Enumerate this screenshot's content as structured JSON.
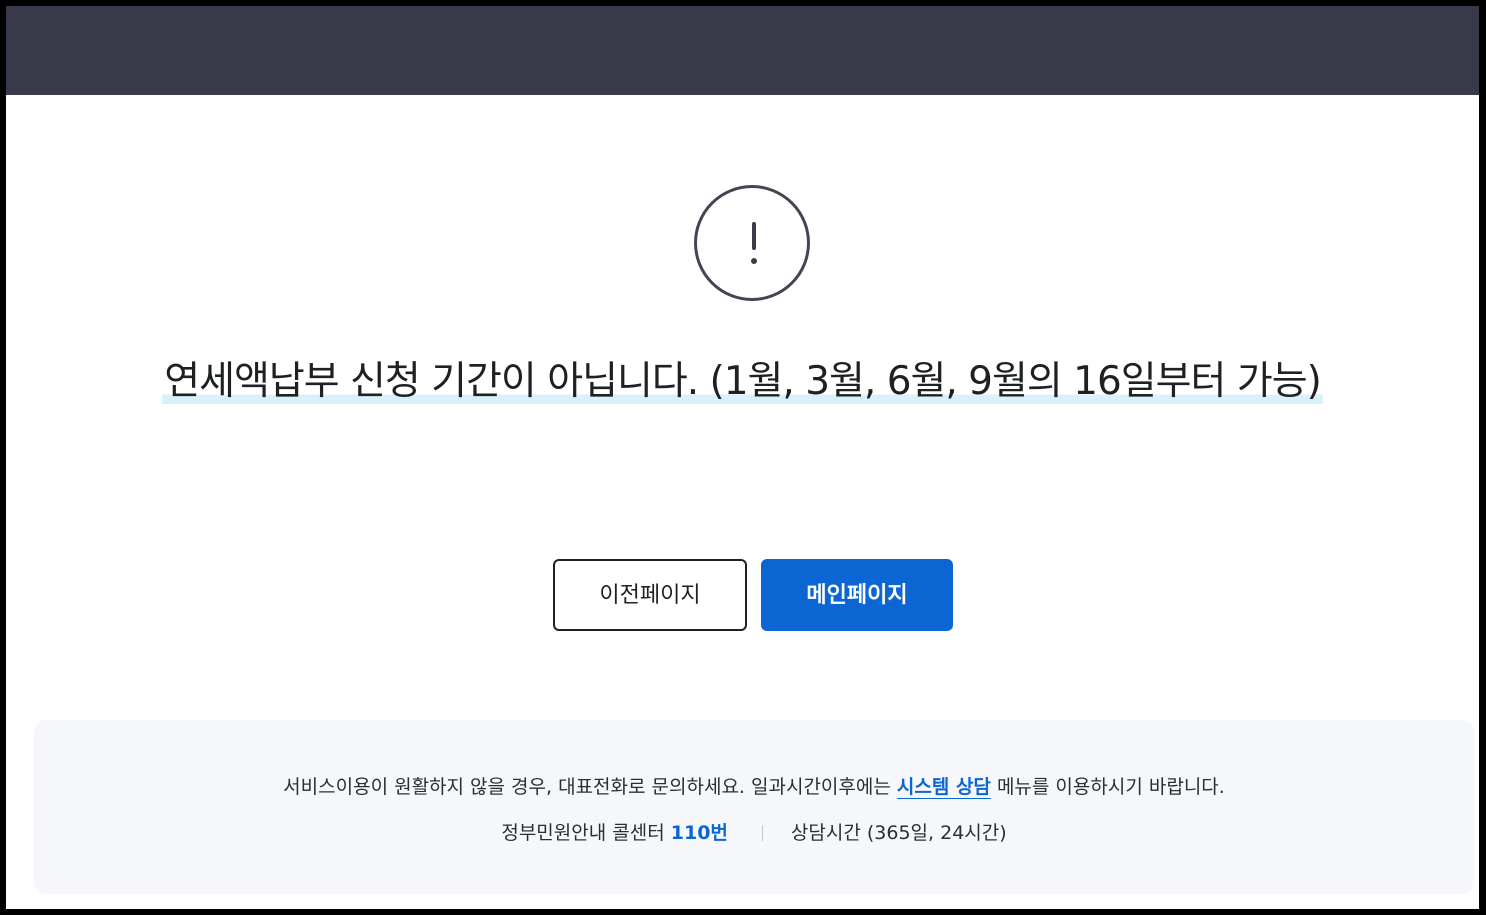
{
  "message": {
    "text": "연세액납부 신청 기간이 아닙니다. (1월, 3월, 6월, 9월의 16일부터 가능)"
  },
  "icons": {
    "alert": "exclamation-circle-icon"
  },
  "buttons": {
    "prev_label": "이전페이지",
    "main_label": "메인페이지"
  },
  "footer": {
    "line1_prefix": "서비스이용이 원활하지 않을 경우, 대표전화로 문의하세요. 일과시간이후에는 ",
    "line1_link": "시스템 상담",
    "line1_suffix": " 메뉴를 이용하시기 바랍니다.",
    "call_center_label": "정부민원안내 콜센터 ",
    "call_center_number": "110번",
    "hours_text": "상담시간 (365일, 24시간)"
  },
  "colors": {
    "header_bg": "#383a49",
    "accent": "#0b66d3",
    "highlight": "#d9f1fb",
    "footer_bg": "#f5f7fa"
  }
}
